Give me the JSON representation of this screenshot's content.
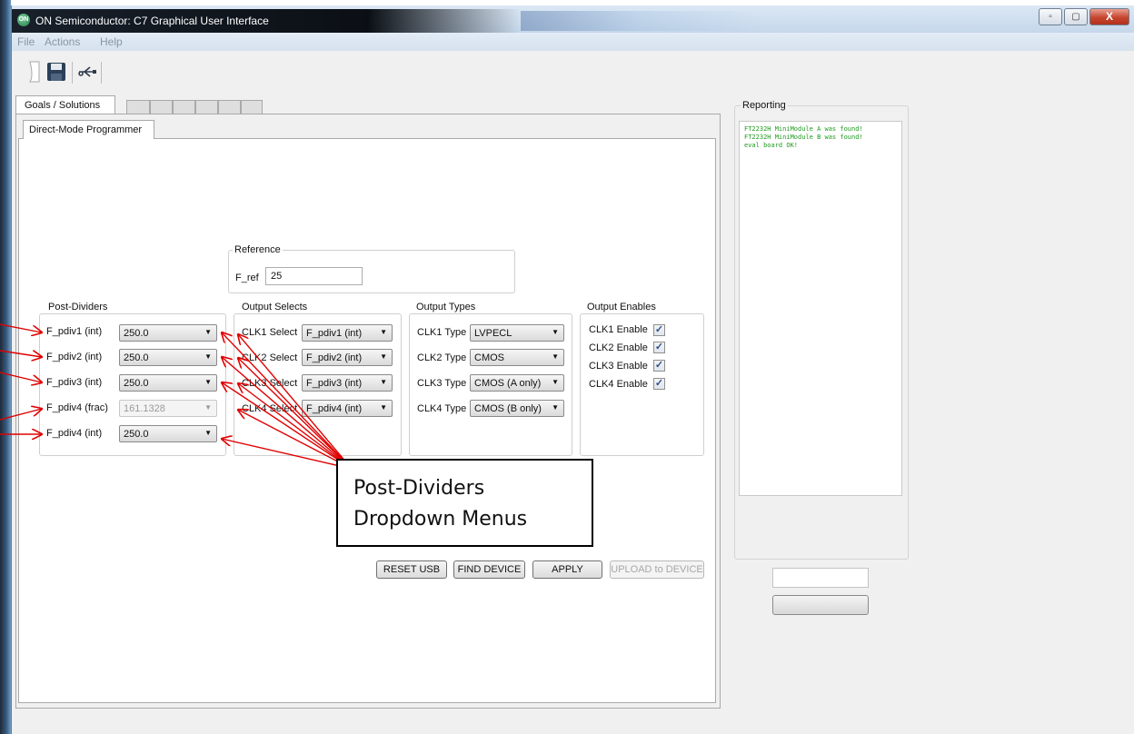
{
  "window": {
    "title": "ON Semiconductor: C7 Graphical User Interface",
    "app_icon_text": "ON"
  },
  "menu": [
    "File",
    "Actions",
    "Help"
  ],
  "tabs": {
    "main": "Goals / Solutions",
    "sub": "Direct-Mode Programmer"
  },
  "reference": {
    "title": "Reference",
    "label": "F_ref",
    "value": "25"
  },
  "post_dividers": {
    "title": "Post-Dividers",
    "rows": [
      {
        "label": "F_pdiv1 (int)",
        "value": "250.0",
        "enabled": true
      },
      {
        "label": "F_pdiv2 (int)",
        "value": "250.0",
        "enabled": true
      },
      {
        "label": "F_pdiv3 (int)",
        "value": "250.0",
        "enabled": true
      },
      {
        "label": "F_pdiv4 (frac)",
        "value": "161.1328",
        "enabled": false
      },
      {
        "label": "F_pdiv4 (int)",
        "value": "250.0",
        "enabled": true
      }
    ]
  },
  "output_selects": {
    "title": "Output Selects",
    "rows": [
      {
        "label": "CLK1 Select",
        "value": "F_pdiv1 (int)"
      },
      {
        "label": "CLK2 Select",
        "value": "F_pdiv2 (int)"
      },
      {
        "label": "CLK3 Select",
        "value": "F_pdiv3 (int)"
      },
      {
        "label": "CLK4 Select",
        "value": "F_pdiv4 (int)"
      }
    ]
  },
  "output_types": {
    "title": "Output Types",
    "rows": [
      {
        "label": "CLK1 Type",
        "value": "LVPECL"
      },
      {
        "label": "CLK2 Type",
        "value": "CMOS"
      },
      {
        "label": "CLK3 Type",
        "value": "CMOS (A only)"
      },
      {
        "label": "CLK4 Type",
        "value": "CMOS (B only)"
      }
    ]
  },
  "output_enables": {
    "title": "Output Enables",
    "rows": [
      {
        "label": "CLK1 Enable",
        "checked": true
      },
      {
        "label": "CLK2 Enable",
        "checked": true
      },
      {
        "label": "CLK3 Enable",
        "checked": true
      },
      {
        "label": "CLK4 Enable",
        "checked": true
      }
    ],
    "check_glyph": "✓"
  },
  "buttons": {
    "reset_usb": "RESET USB",
    "find_device": "FIND DEVICE",
    "apply": "APPLY",
    "upload": "UPLOAD to DEVICE"
  },
  "reporting": {
    "title": "Reporting",
    "lines": [
      "FT2232H MiniModule A was found!",
      "FT2232H MiniModule B was found!",
      "eval board OK!"
    ]
  },
  "annotation": {
    "line1": "Post-Dividers",
    "line2": "Dropdown Menus",
    "color": "#e00000"
  },
  "icons": {
    "new": "new-file-icon",
    "save": "save-icon",
    "usb": "usb-icon",
    "minimize": "minimize-icon",
    "maximize": "maximize-icon",
    "close": "close-icon",
    "dropdown": "chevron-down-icon"
  },
  "glyphs": {
    "dropdown": "▼",
    "close": "X"
  }
}
